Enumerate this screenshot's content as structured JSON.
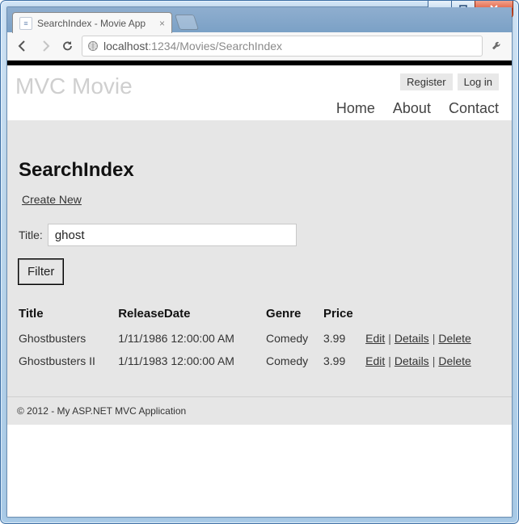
{
  "window": {
    "tab_title": "SearchIndex - Movie App",
    "url_display_prefix": "localhost",
    "url_display_rest": ":1234/Movies/SearchIndex"
  },
  "header": {
    "brand": "MVC Movie",
    "register": "Register",
    "login": "Log in",
    "nav": {
      "home": "Home",
      "about": "About",
      "contact": "Contact"
    }
  },
  "page": {
    "title": "SearchIndex",
    "create_link": "Create New",
    "search_label": "Title:",
    "search_value": "ghost",
    "filter_label": "Filter"
  },
  "table": {
    "cols": {
      "title": "Title",
      "release": "ReleaseDate",
      "genre": "Genre",
      "price": "Price"
    },
    "actions": {
      "edit": "Edit",
      "details": "Details",
      "delete": "Delete"
    },
    "rows": [
      {
        "title": "Ghostbusters",
        "release": "1/11/1986 12:00:00 AM",
        "genre": "Comedy",
        "price": "3.99"
      },
      {
        "title": "Ghostbusters II",
        "release": "1/11/1983 12:00:00 AM",
        "genre": "Comedy",
        "price": "3.99"
      }
    ]
  },
  "footer": "© 2012 - My ASP.NET MVC Application"
}
